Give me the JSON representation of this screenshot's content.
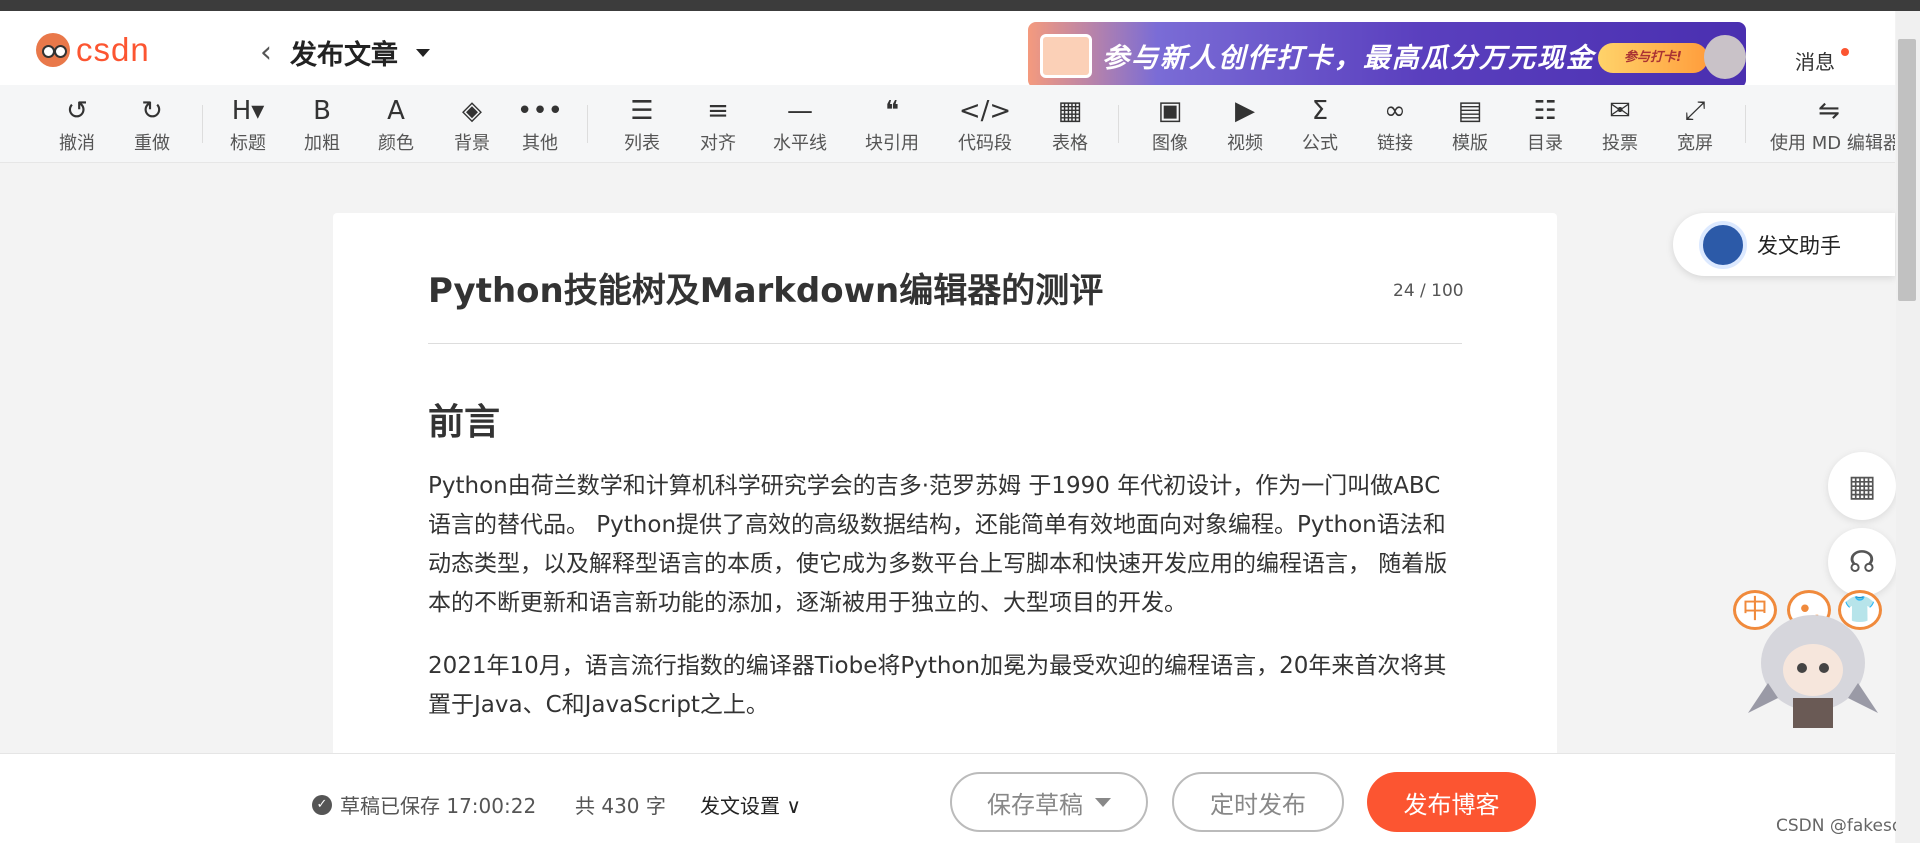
{
  "header": {
    "logo_text": "csdn",
    "page_title": "发布文章",
    "banner_text": "参与新人创作打卡，最高瓜分万元现金",
    "banner_button": "参与打卡!",
    "messages_label": "消息"
  },
  "toolbar": [
    {
      "icon": "undo-icon",
      "glyph": "↺",
      "label": "撤消"
    },
    {
      "icon": "redo-icon",
      "glyph": "↻",
      "label": "重做"
    },
    {
      "icon": "heading-icon",
      "glyph": "H▾",
      "label": "标题"
    },
    {
      "icon": "bold-icon",
      "glyph": "B",
      "label": "加粗"
    },
    {
      "icon": "color-icon",
      "glyph": "A",
      "label": "颜色"
    },
    {
      "icon": "background-icon",
      "glyph": "◈",
      "label": "背景"
    },
    {
      "icon": "more-icon",
      "glyph": "•••",
      "label": "其他"
    },
    {
      "icon": "list-icon",
      "glyph": "☰",
      "label": "列表"
    },
    {
      "icon": "align-icon",
      "glyph": "≡",
      "label": "对齐"
    },
    {
      "icon": "hr-icon",
      "glyph": "—",
      "label": "水平线"
    },
    {
      "icon": "quote-icon",
      "glyph": "❝",
      "label": "块引用"
    },
    {
      "icon": "code-icon",
      "glyph": "</>",
      "label": "代码段"
    },
    {
      "icon": "table-icon",
      "glyph": "▦",
      "label": "表格"
    },
    {
      "icon": "image-icon",
      "glyph": "▣",
      "label": "图像"
    },
    {
      "icon": "video-icon",
      "glyph": "▶",
      "label": "视频"
    },
    {
      "icon": "formula-icon",
      "glyph": "Σ",
      "label": "公式"
    },
    {
      "icon": "link-icon",
      "glyph": "∞",
      "label": "链接"
    },
    {
      "icon": "template-icon",
      "glyph": "▤",
      "label": "模版"
    },
    {
      "icon": "toc-icon",
      "glyph": "☷",
      "label": "目录"
    },
    {
      "icon": "vote-icon",
      "glyph": "✉",
      "label": "投票"
    },
    {
      "icon": "widescreen-icon",
      "glyph": "⤢",
      "label": "宽屏"
    },
    {
      "icon": "md-switch-icon",
      "glyph": "⇋",
      "label": "使用 MD 编辑器"
    }
  ],
  "article": {
    "title": "Python技能树及Markdown编辑器的测评",
    "title_count": "24 / 100",
    "heading": "前言",
    "paragraphs": [
      "Python由荷兰数学和计算机科学研究学会的吉多·范罗苏姆 于1990 年代初设计，作为一门叫做ABC语言的替代品。 Python提供了高效的高级数据结构，还能简单有效地面向对象编程。Python语法和动态类型，以及解释型语言的本质，使它成为多数平台上写脚本和快速开发应用的编程语言， 随着版本的不断更新和语言新功能的添加，逐渐被用于独立的、大型项目的开发。",
      "2021年10月，语言流行指数的编译器Tiobe将Python加冕为最受欢迎的编程语言，20年来首次将其置于Java、C和JavaScript之上。"
    ]
  },
  "assistant": {
    "label": "发文助手"
  },
  "side_bubbles": [
    "中",
    "•,",
    "👕"
  ],
  "footer": {
    "saved_text": "草稿已保存 17:00:22",
    "word_count": "共 430 字",
    "settings_label": "发文设置",
    "save_draft": "保存草稿",
    "schedule": "定时发布",
    "publish": "发布博客"
  },
  "watermark": "CSDN @fakesd"
}
